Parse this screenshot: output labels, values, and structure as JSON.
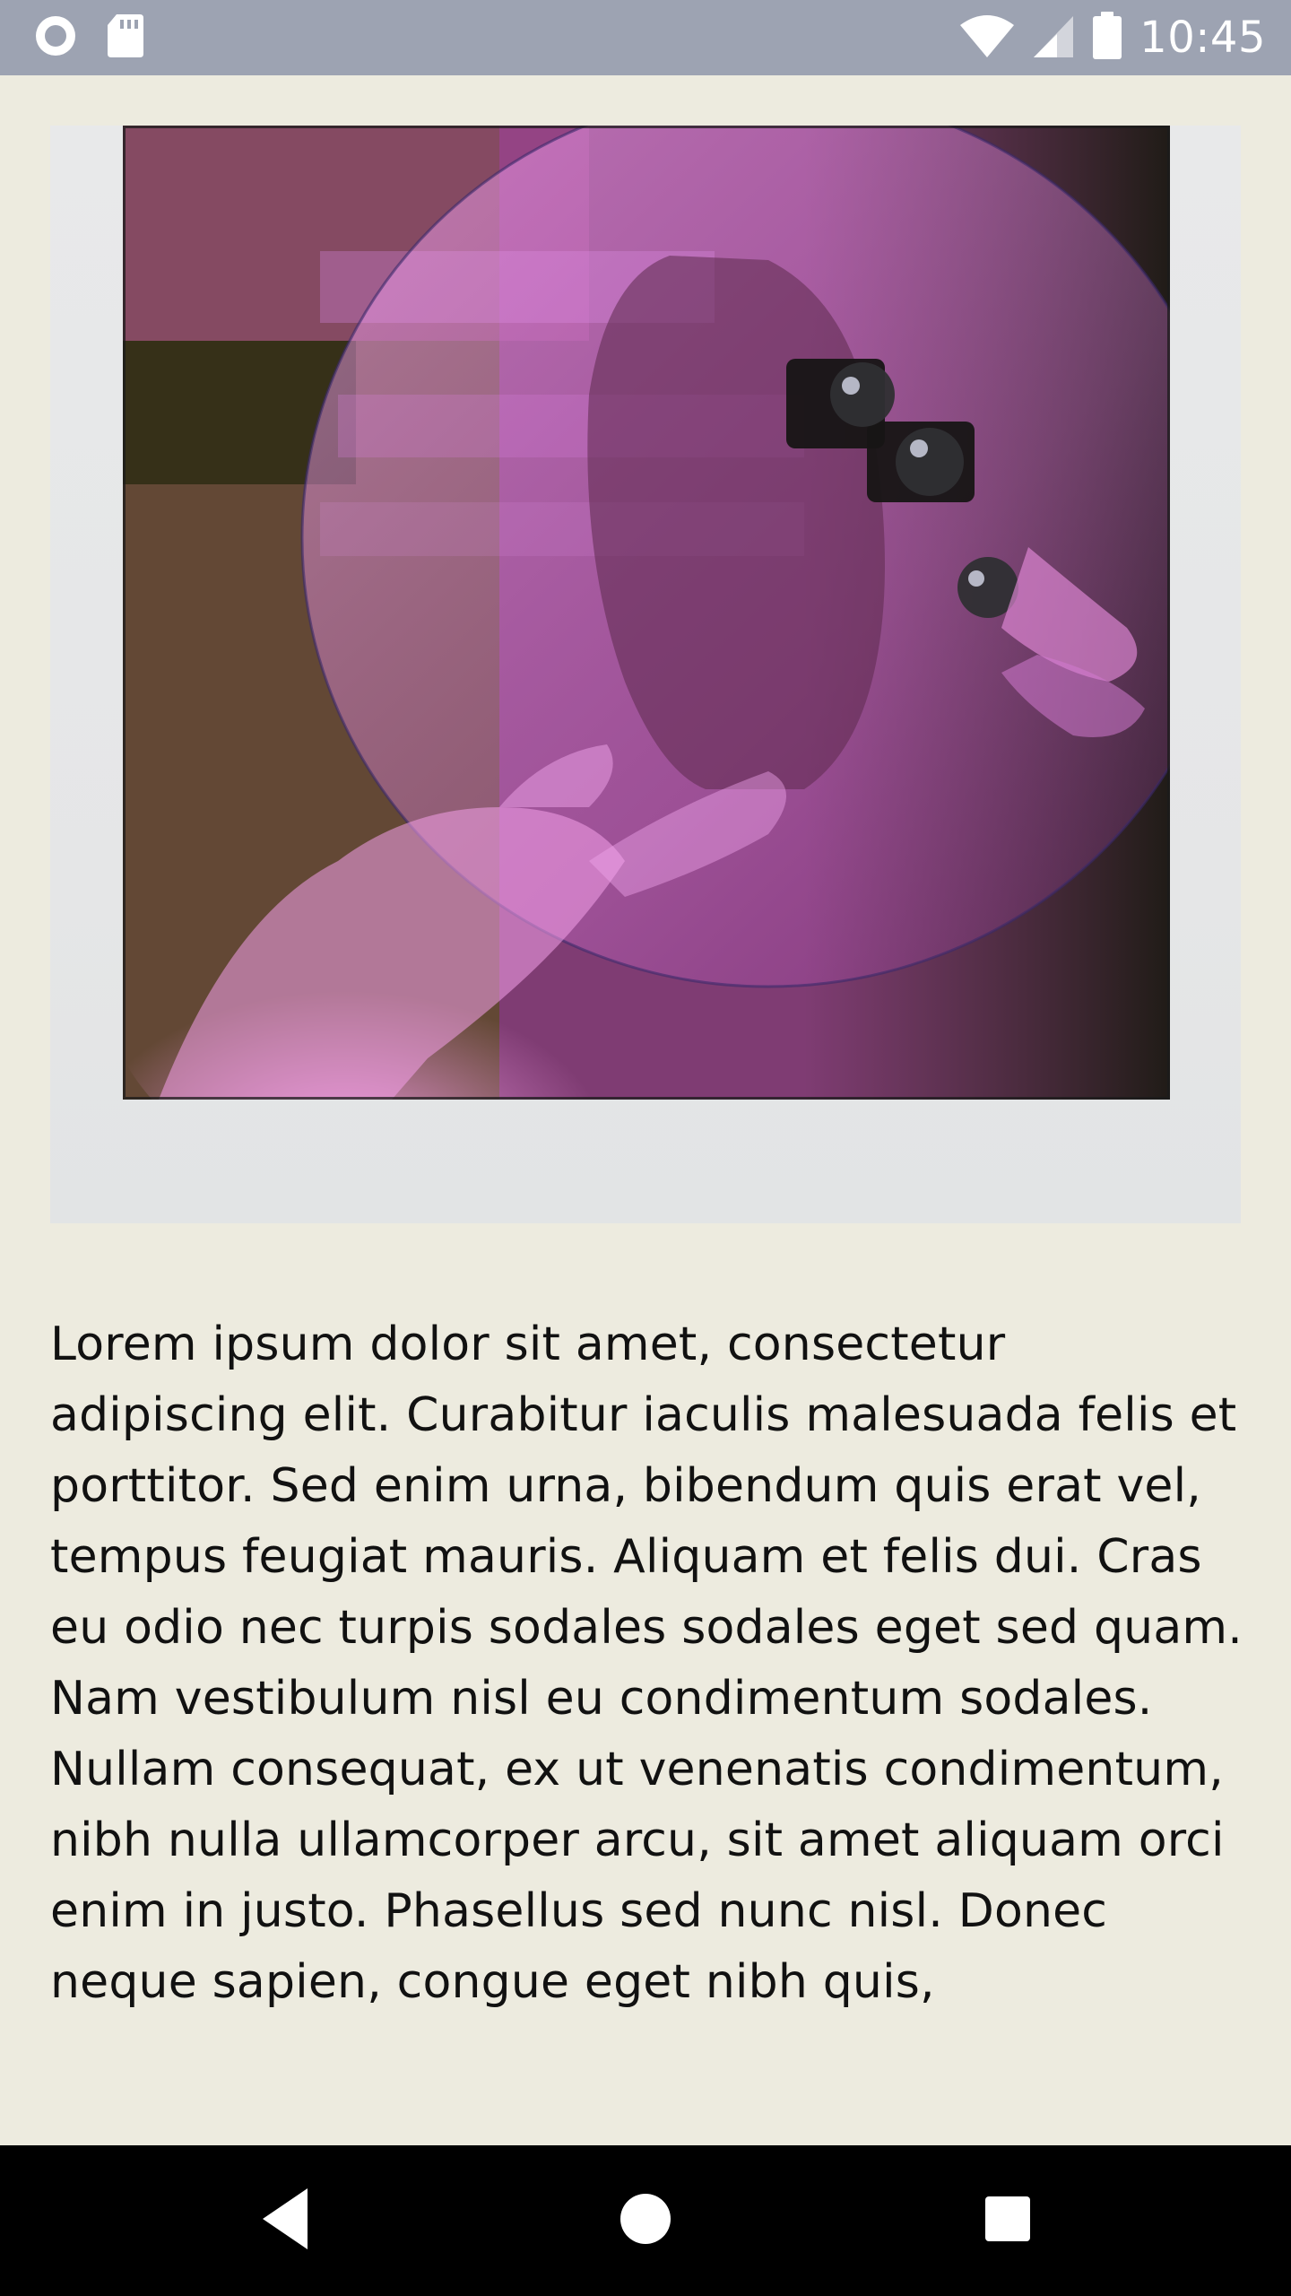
{
  "status_bar": {
    "time": "10:45",
    "icons": [
      "circle-status-icon",
      "sd-card-icon",
      "wifi-icon",
      "signal-icon",
      "battery-icon"
    ]
  },
  "main": {
    "image": {
      "description": "polaroid-photo-magenta-mirror-selfie"
    },
    "body_text": "Lorem ipsum dolor sit amet, consectetur adipiscing elit. Curabitur iaculis malesuada felis et porttitor. Sed enim urna, bibendum quis erat vel, tempus feugiat mauris. Aliquam et felis dui. Cras eu odio nec turpis sodales sodales eget sed quam. Nam vestibulum nisl eu condimentum sodales. Nullam consequat, ex ut venenatis condimentum, nibh nulla ullamcorper arcu, sit amet aliquam orci enim in justo. Phasellus sed nunc nisl. Donec neque sapien, congue eget nibh quis,"
  },
  "nav_bar": {
    "buttons": [
      "back-icon",
      "home-icon",
      "recents-icon"
    ]
  },
  "colors": {
    "status_bar_bg": "#9da3b2",
    "page_bg": "#edebdf",
    "nav_bar_bg": "#000000",
    "text": "#111111"
  }
}
